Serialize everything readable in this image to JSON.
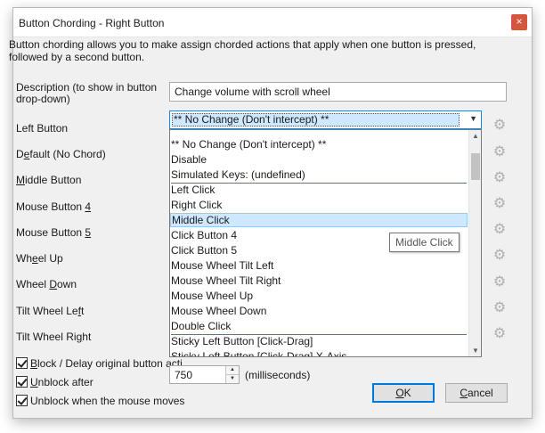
{
  "window": {
    "title": "Button Chording - Right Button",
    "close_glyph": "×"
  },
  "intro": "Button chording allows you to make assign chorded actions that apply when one button is pressed, followed by a second button.",
  "description": {
    "label": "Description (to show in button drop-down)",
    "value": "Change volume with scroll wheel"
  },
  "labels": {
    "left_button": "Left Button",
    "default_pre": "D",
    "default_key": "e",
    "default_post": "fault (No Chord)",
    "middle_key": "M",
    "middle_post": "iddle Button",
    "mb4_pre": "Mouse Button ",
    "mb4_key": "4",
    "mb5_pre": "Mouse Button ",
    "mb5_key": "5",
    "wheel_up_pre": "Wh",
    "wheel_up_key": "e",
    "wheel_up_post": "el Up",
    "wheel_down_pre": "Wheel ",
    "wheel_down_key": "D",
    "wheel_down_post": "own",
    "tilt_left_pre": "Tilt Wheel Le",
    "tilt_left_key": "f",
    "tilt_left_post": "t",
    "tilt_right_pre": "Tilt Wheel Ri",
    "tilt_right_key": "g",
    "tilt_right_post": "ht"
  },
  "combo": {
    "selected": "** No Change (Don't intercept) **",
    "arrow": "▼"
  },
  "dropdown": {
    "options": [
      "** No Change (Don't intercept) **",
      "Disable",
      "Simulated Keys: (undefined)",
      "Left Click",
      "Right Click",
      "Middle Click",
      "Click Button 4",
      "Click Button 5",
      "Mouse Wheel Tilt Left",
      "Mouse Wheel Tilt Right",
      "Mouse Wheel Up",
      "Mouse Wheel Down",
      "Double Click",
      "Sticky Left Button [Click-Drag]",
      "Sticky Left Button [Click-Drag] X-Axis"
    ],
    "highlighted": "Middle Click",
    "scroll_up": "▲",
    "scroll_down": "▼"
  },
  "tooltip": "Middle Click",
  "checkboxes": {
    "block_key": "B",
    "block_rest": "lock / Delay original button acti",
    "unblock_key": "U",
    "unblock_rest": "nblock after",
    "mouse_moves": "Unblock when the mouse moves"
  },
  "unblock_ms": {
    "value": "750",
    "unit": "(milliseconds)",
    "up": "▲",
    "down": "▼"
  },
  "buttons": {
    "ok_key": "O",
    "ok_rest": "K",
    "cancel_key": "C",
    "cancel_rest": "ancel"
  },
  "icons": {
    "gear_glyph": "⚙"
  }
}
